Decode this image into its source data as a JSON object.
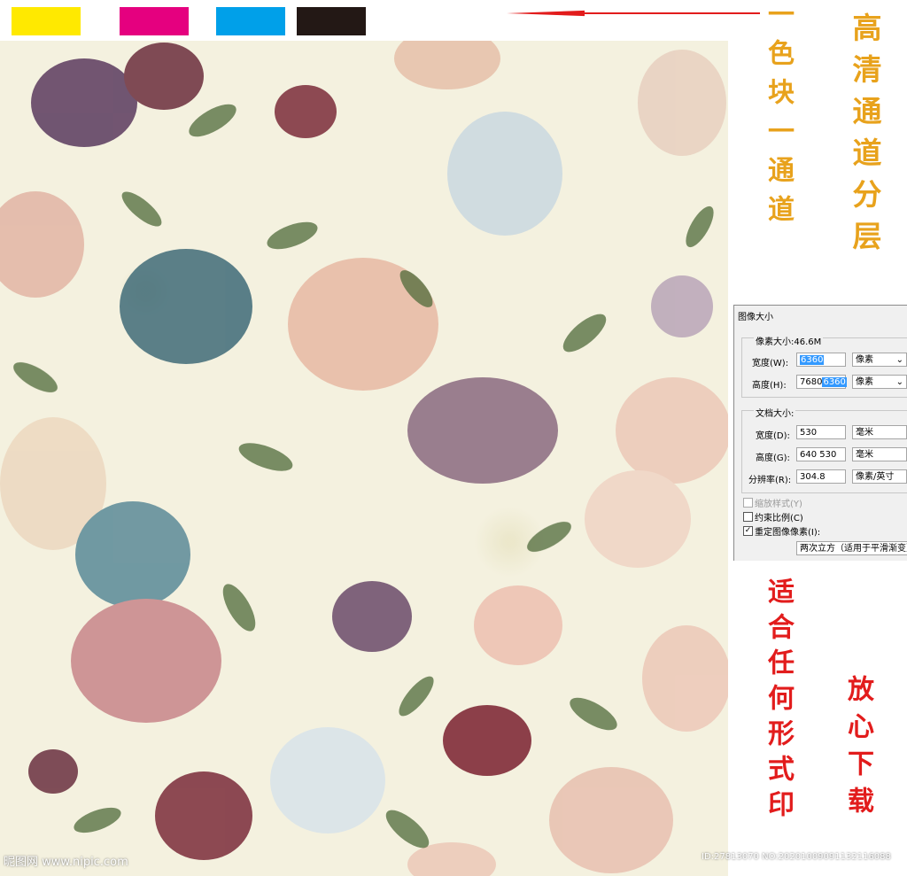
{
  "swatches": [
    {
      "name": "yellow",
      "color": "#ffe900"
    },
    {
      "name": "magenta",
      "color": "#e5007f"
    },
    {
      "name": "cyan",
      "color": "#00a0e9"
    },
    {
      "name": "black",
      "color": "#231815"
    }
  ],
  "captions": {
    "channel_per_swatch": "一色块一通道",
    "hd_layers": "高清通道分层",
    "suitable_print": "适合任何形式印",
    "download": "放心下载"
  },
  "dialog": {
    "title": "图像大小",
    "pixel_size_label": "像素大小:46.6M",
    "width_label": "宽度(W):",
    "width_value": "6360",
    "width_unit": "像素",
    "height_label": "高度(H):",
    "height_old": "7680",
    "height_value": "6360",
    "height_unit": "像素",
    "doc_size_label": "文档大小:",
    "doc_width_label": "宽度(D):",
    "doc_width_value": "530",
    "doc_width_unit": "毫米",
    "doc_height_label": "高度(G):",
    "doc_height_old": "640",
    "doc_height_value": "530",
    "doc_height_unit": "毫米",
    "resolution_label": "分辨率(R):",
    "resolution_value": "304.8",
    "resolution_unit": "像素/英寸",
    "scale_styles": "缩放样式(Y)",
    "constrain": "约束比例(C)",
    "resample": "重定图像像素(I):",
    "resample_method": "两次立方（适用于平滑渐变）"
  },
  "watermarks": {
    "logo": "昵图网 www.nipic.com",
    "id": "ID:27813070 NO:20201009091132116088"
  },
  "colors": {
    "caption_gold": "#e8a21c",
    "caption_red": "#e21c1c"
  }
}
